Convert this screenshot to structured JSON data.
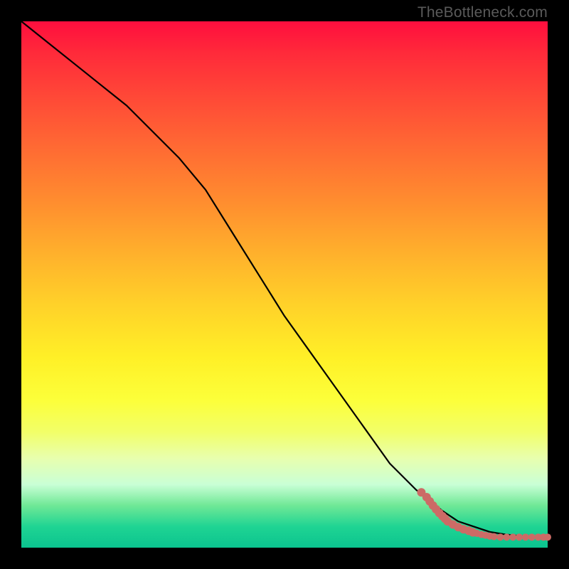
{
  "watermark": "TheBottleneck.com",
  "colors": {
    "background_frame": "#000000",
    "curve": "#000000",
    "points": "#cc6b66"
  },
  "chart_data": {
    "type": "line",
    "title": "",
    "xlabel": "",
    "ylabel": "",
    "xlim": [
      0,
      100
    ],
    "ylim": [
      0,
      100
    ],
    "grid": false,
    "legend": false,
    "series": [
      {
        "name": "curve",
        "style": "line",
        "x": [
          0,
          5,
          10,
          15,
          20,
          25,
          30,
          35,
          40,
          45,
          50,
          55,
          60,
          65,
          70,
          75,
          80,
          83,
          86,
          89,
          92,
          95,
          98,
          100
        ],
        "y": [
          100,
          96,
          92,
          88,
          84,
          79,
          74,
          68,
          60,
          52,
          44,
          37,
          30,
          23,
          16,
          11,
          7,
          5,
          4,
          3,
          2.5,
          2.2,
          2.0,
          2.0
        ]
      },
      {
        "name": "scatter-points",
        "style": "scatter",
        "x": [
          76,
          77,
          77.6,
          78.2,
          78.8,
          79.4,
          80,
          80.5,
          81,
          82,
          83,
          84,
          85,
          85.8,
          86.6,
          87.4,
          88.2,
          89,
          89.8,
          91,
          92.2,
          93.4,
          94.6,
          95.8,
          97,
          98.2,
          99.2,
          100
        ],
        "y": [
          10.5,
          9.6,
          8.8,
          8.0,
          7.3,
          6.6,
          6.0,
          5.5,
          5.0,
          4.4,
          3.9,
          3.5,
          3.2,
          2.9,
          2.7,
          2.5,
          2.35,
          2.2,
          2.1,
          2.0,
          2.0,
          2.0,
          2.0,
          2.0,
          2.0,
          2.0,
          2.0,
          2.0
        ]
      }
    ]
  }
}
